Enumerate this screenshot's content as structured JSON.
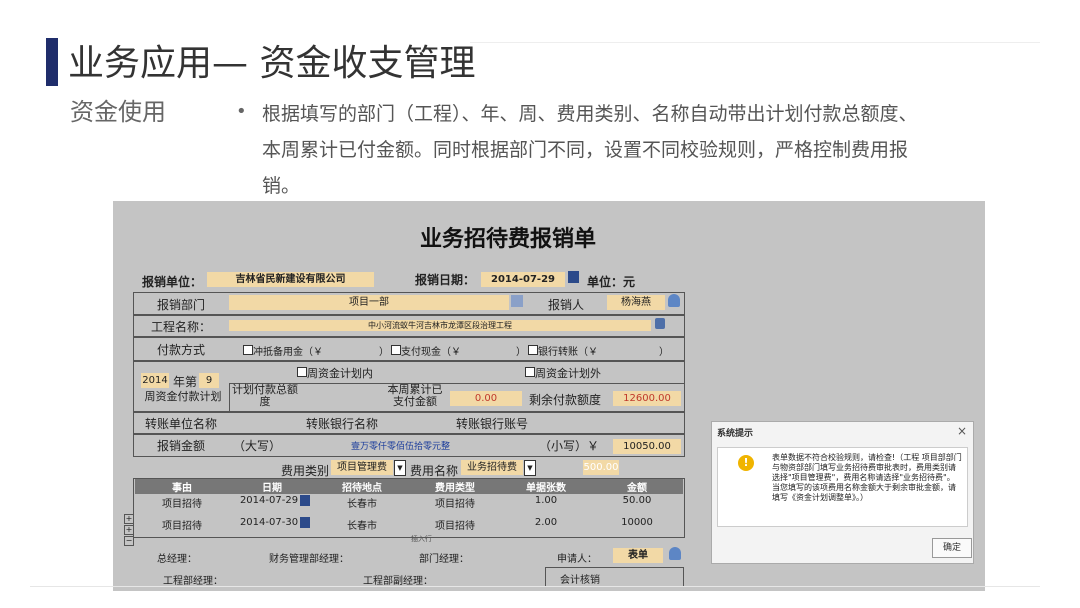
{
  "slide": {
    "title": "业务应用— 资金收支管理",
    "subtitle": "资金使用",
    "bullet": "根据填写的部门（工程）、年、周、费用类别、名称自动带出计划付款总额度、本周累计已付金额。同时根据部门不同，设置不同校验规则，严格控制费用报销。"
  },
  "form": {
    "title": "业务招待费报销单",
    "unit_label": "报销单位：",
    "unit_value": "吉林省民新建设有限公司",
    "date_label": "报销日期：",
    "date_value": "2014-07-29",
    "currency_label": "单位：元",
    "dept_label": "报销部门",
    "dept_value": "项目一部",
    "person_label": "报销人",
    "person_value": "杨海燕",
    "project_label": "工程名称：",
    "project_value": "中小河流蚁牛河吉林市龙潭区段治理工程",
    "pay_label": "付款方式",
    "pay_opt1": "冲抵备用金（￥",
    "pay_opt2": "）",
    "pay_opt3": "支付现金（￥",
    "pay_opt4": "）",
    "pay_opt5": "银行转账（￥",
    "pay_opt6": "）",
    "year_value": "2014",
    "year_label": "年第",
    "week_value": "9",
    "plan_in": "周资金计划内",
    "plan_out": "周资金计划外",
    "weekly_plan_label": "周资金付款计划",
    "plan_total_label": "计划付款总额度",
    "week_paid_label": "本周累计已支付金额",
    "week_paid_value": "0.00",
    "remain_label": "剩余付款额度",
    "remain_value": "12600.00",
    "trans_unit_label": "转账单位名称",
    "trans_bank_label": "转账银行名称",
    "trans_account_label": "转账银行账号",
    "amount_label": "报销金额",
    "amount_upper_label": "（大写）",
    "amount_upper_value": "壹万零仟零佰伍拾零元整",
    "amount_lower_label": "（小写）￥",
    "amount_lower_value": "10050.00",
    "fee_type_label": "费用类别",
    "fee_type_value": "项目管理费",
    "fee_name_label": "费用名称",
    "fee_name_value": "业务招待费",
    "fee_extra_value": "500.00",
    "table": {
      "headers": [
        "事由",
        "日期",
        "招待地点",
        "费用类型",
        "单据张数",
        "金额"
      ],
      "rows": [
        [
          "项目招待",
          "2014-07-29",
          "长春市",
          "项目招待",
          "1.00",
          "50.00"
        ],
        [
          "项目招待",
          "2014-07-30",
          "长春市",
          "项目招待",
          "2.00",
          "10000"
        ]
      ],
      "insert_row": "插入行"
    },
    "gm_label": "总经理：",
    "finance_label": "财务管理部经理：",
    "dept_mgr_label": "部门经理：",
    "applicant_label": "申请人：",
    "applicant_value": "表单",
    "eng_mgr_label": "工程部经理：",
    "eng_vice_label": "工程部副经理：",
    "accounting_label": "会计核销"
  },
  "dialog": {
    "title": "系统提示",
    "close": "×",
    "message": "表单数据不符合校验规则，请检查!（工程 项目部部门与物资部部门填写业务招待费审批表时，费用类别请选择\"项目管理费\"，费用名称请选择\"业务招待费\"。当您填写的该项费用名称金额大于剩余审批金额，请填写《资金计划调整单》。）",
    "ok": "确定"
  },
  "colors": {
    "accent": "#1f2d6b",
    "field": "#f2d9a6",
    "red": "#c0392b",
    "blue": "#1a3c9b"
  }
}
